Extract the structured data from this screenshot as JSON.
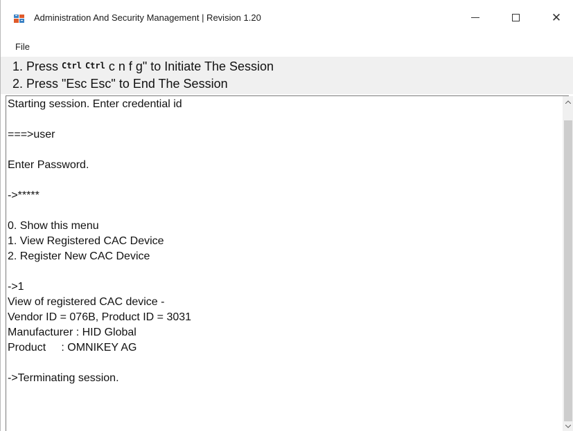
{
  "window": {
    "title": "Administration And Security Management | Revision 1.20"
  },
  "menu": {
    "file": "File"
  },
  "instructions": {
    "line1_prefix": "1. Press ",
    "line1_key1": "Ctrl",
    "line1_key2": "Ctrl",
    "line1_suffix": " c n f g\" to Initiate The Session",
    "line2": "2. Press \"Esc Esc\" to End The Session"
  },
  "console": {
    "lines": [
      "Starting session. Enter credential id",
      "",
      "===>user",
      "",
      "Enter Password.",
      "",
      "->*****",
      "",
      "0. Show this menu",
      "1. View Registered CAC Device",
      "2. Register New CAC Device",
      "",
      "->1",
      "View of registered CAC device -",
      "Vendor ID = 076B, Product ID = 3031",
      "Manufacturer : HID Global",
      "Product     : OMNIKEY AG",
      "",
      "->Terminating session."
    ]
  },
  "icons": {
    "app": "app-window-icon",
    "minimize": "minimize-icon",
    "maximize": "maximize-icon",
    "close": "close-icon",
    "scroll_up": "chevron-up-icon",
    "scroll_down": "chevron-down-icon"
  },
  "colors": {
    "instruction_bg": "#f0f0f0",
    "scrollbar_thumb": "#cdcdcd"
  }
}
